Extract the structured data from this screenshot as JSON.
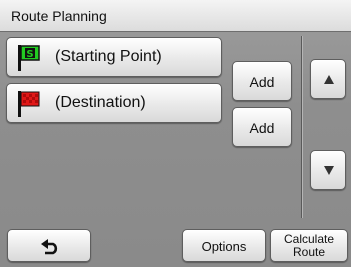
{
  "title": "Route Planning",
  "waypoints": [
    {
      "label": "(Starting Point)",
      "flag_color": "#22cc22",
      "flag_letter": "S"
    },
    {
      "label": "(Destination)",
      "flag_color": "#e01818"
    }
  ],
  "add_label": "Add",
  "scroll": {
    "up_icon": "triangle-up-icon",
    "down_icon": "triangle-down-icon"
  },
  "footer": {
    "back_icon": "return-arrow-icon",
    "options_label": "Options",
    "calculate_line1": "Calculate",
    "calculate_line2": "Route"
  },
  "colors": {
    "accent_green": "#22cc22",
    "accent_red": "#e01818"
  }
}
